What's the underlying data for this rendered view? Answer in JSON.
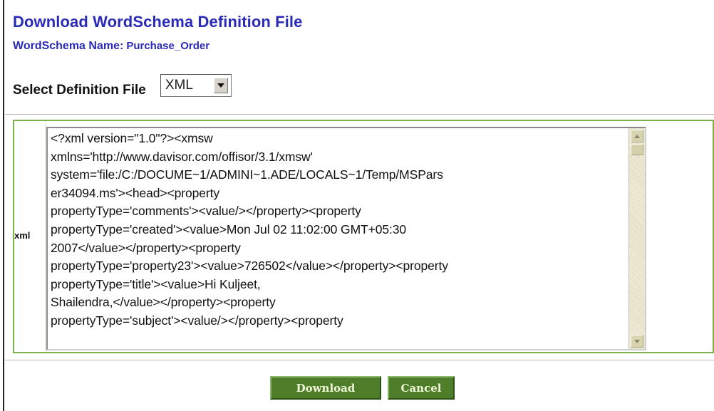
{
  "header": {
    "title": "Download WordSchema Definition File",
    "schema_label": "WordSchema Name:",
    "schema_name": "Purchase_Order"
  },
  "selector": {
    "label": "Select Definition File",
    "selected": "XML"
  },
  "panel": {
    "row_label": "xml",
    "xml_lines": [
      "<?xml version=\"1.0\"?><xmsw",
      "xmlns='http://www.davisor.com/offisor/3.1/xmsw'",
      "system='file:/C:/DOCUME~1/ADMINI~1.ADE/LOCALS~1/Temp/MSPars",
      "er34094.ms'><head><property",
      "propertyType='comments'><value/></property><property",
      "propertyType='created'><value>Mon Jul 02 11:02:00 GMT+05:30",
      "2007</value></property><property",
      "propertyType='property23'><value>726502</value></property><property",
      "propertyType='title'><value>Hi Kuljeet,",
      "Shailendra,</value></property><property",
      "propertyType='subject'><value/></property><property"
    ]
  },
  "actions": {
    "download_label": "Download",
    "cancel_label": "Cancel"
  },
  "colors": {
    "title": "#2a2ab8",
    "panel_border": "#7bb04a",
    "button_bg": "#4f7e2a",
    "button_text": "#f2f6d8",
    "scrollbar_track": "#ede8d2"
  }
}
